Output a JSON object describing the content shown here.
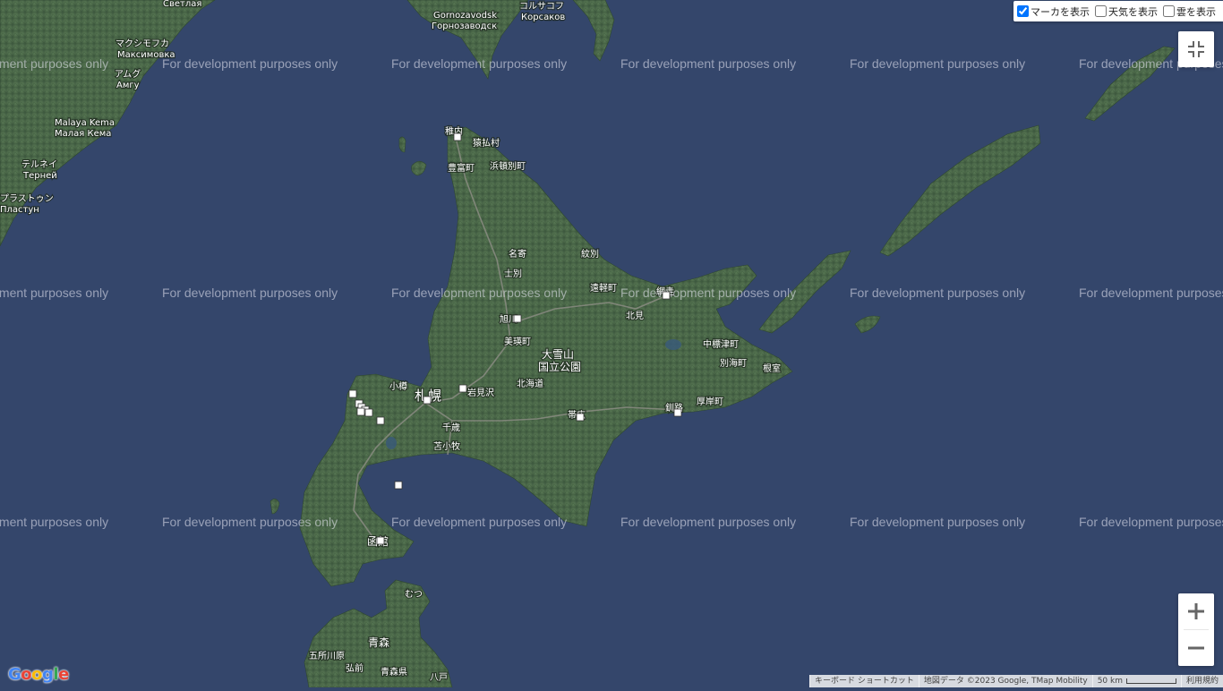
{
  "layer_controls": {
    "markers": {
      "label": "マーカを表示",
      "checked": true
    },
    "weather": {
      "label": "天気を表示",
      "checked": false
    },
    "clouds": {
      "label": "雲を表示",
      "checked": false
    }
  },
  "watermark_text": "For development purposes only",
  "map_labels": [
    "Светлая",
    "Gornozavodsk",
    "Горнозаводск",
    "コルサコフ",
    "Корсаков",
    "マクシモフカ",
    "Максимовка",
    "アムグ",
    "Амгу",
    "Malaya Kema",
    "Малая Кема",
    "テルネイ",
    "Терней",
    "プラストゥン",
    "Пластун",
    "稚内",
    "猿払村",
    "豊富町",
    "浜頓別町",
    "名寄",
    "士別",
    "紋別",
    "遠軽町",
    "網走",
    "北見",
    "旭川",
    "美瑛町",
    "大雪山",
    "国立公園",
    "中標津町",
    "別海町",
    "根室",
    "小樽",
    "札幌",
    "岩見沢",
    "北海道",
    "千歳",
    "苫小牧",
    "帯広",
    "釧路",
    "厚岸町",
    "函館",
    "むつ",
    "青森",
    "五所川原",
    "弘前",
    "青森県",
    "八戸"
  ],
  "attribution": {
    "keyboard_shortcuts": "キーボード ショートカット",
    "map_data": "地図データ ©2023 Google, TMap Mobility",
    "scale": "50 km",
    "terms": "利用規約"
  },
  "logo": {
    "text": "Google",
    "colors": [
      "#4285F4",
      "#EA4335",
      "#FBBC05",
      "#4285F4",
      "#34A853",
      "#EA4335"
    ]
  },
  "icons": {
    "fullscreen": "fullscreen-exit-icon",
    "zoom_in": "plus-icon",
    "zoom_out": "minus-icon"
  },
  "colors": {
    "sea": "#34466b",
    "land": "#4d6a4c",
    "marker": "#ffffff"
  }
}
